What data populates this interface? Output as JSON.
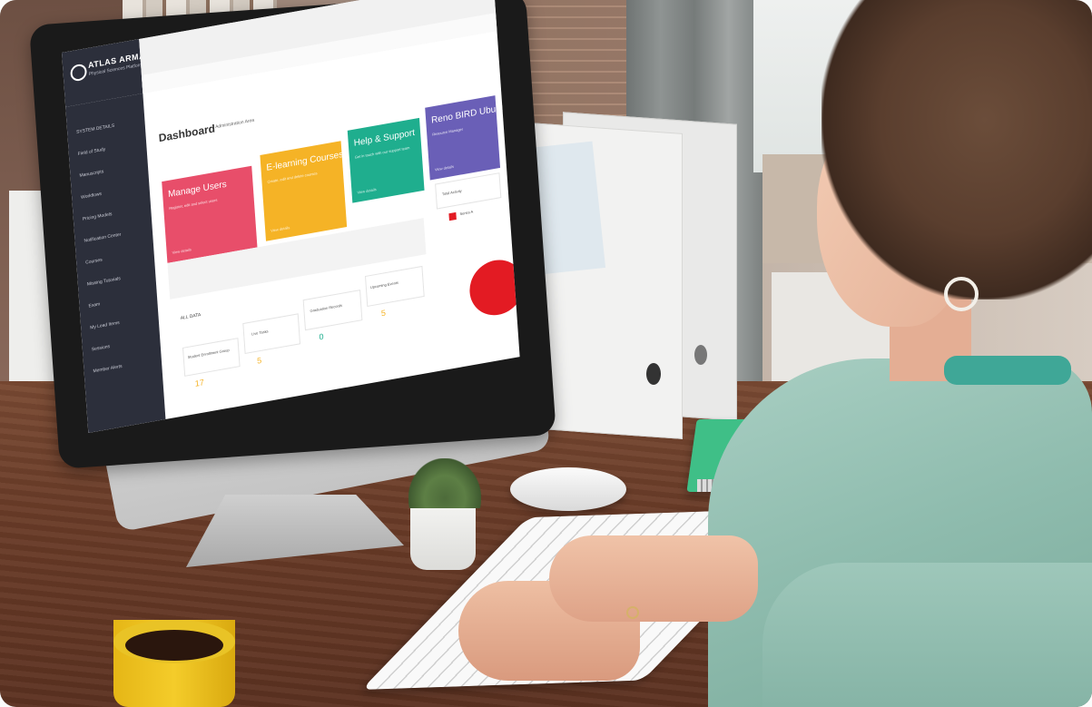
{
  "screen": {
    "brand": {
      "name": "ATLAS ARMAS",
      "tagline": "Physical Sciences Platform"
    },
    "sidebar": {
      "items": [
        "SYSTEM DETAILS",
        "Field of Study",
        "Manuscripts",
        "Workflows",
        "Pricing Models",
        "Notification Center",
        "Courses",
        "Missing Tutorials",
        "Exam",
        "My Lead Items",
        "Sessions",
        "Member Alerts"
      ]
    },
    "header": {
      "title": "Dashboard",
      "subtitle": "Administration Area"
    },
    "cards": [
      {
        "title": "Manage Users",
        "desc": "Register, edit and select users",
        "footer": "View details",
        "color": "#e84e6a"
      },
      {
        "title": "E-learning Courses",
        "desc": "Create, edit and delete courses",
        "footer": "View details",
        "color": "#f5b326"
      },
      {
        "title": "Help & Support",
        "desc": "Get in touch with our support team",
        "footer": "View details",
        "color": "#1fae8e"
      },
      {
        "title": "Reno BIRD Ubuntu",
        "desc": "Resource Manager",
        "footer": "View details",
        "color": "#6a5fb7"
      }
    ],
    "panels": {
      "panel_label": "ALL DATA",
      "stat_labels": [
        "Student Enrollment Group",
        "Live Tasks",
        "Graduation Records",
        "Upcoming Events"
      ],
      "stat_values": [
        "17",
        "5",
        "0",
        "5"
      ],
      "legend": {
        "label": "Series A",
        "color": "#e31b23"
      },
      "side_box": "Total Activity"
    }
  }
}
